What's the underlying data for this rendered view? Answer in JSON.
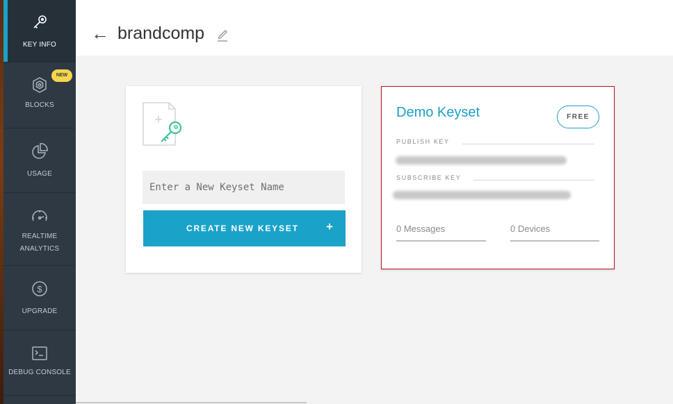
{
  "app": {
    "title": "brandcomp"
  },
  "header": {
    "back_icon": "back-arrow-icon",
    "edit_icon": "pencil-icon"
  },
  "sidebar": {
    "items": [
      {
        "label": "KEY INFO",
        "icon": "key-icon",
        "active": true
      },
      {
        "label": "BLOCKS",
        "icon": "blocks-icon",
        "badge": "NEW"
      },
      {
        "label": "USAGE",
        "icon": "pie-chart-icon"
      },
      {
        "label": "REALTIME\nANALYTICS",
        "icon": "speedometer-icon"
      },
      {
        "label": "UPGRADE",
        "icon": "dollar-icon"
      },
      {
        "label": "DEBUG CONSOLE",
        "icon": "terminal-icon"
      }
    ]
  },
  "create_card": {
    "icon": "add-keyset-icon",
    "input_placeholder": "Enter a New Keyset Name",
    "input_value": "",
    "button_label": "CREATE NEW KEYSET",
    "button_plus": "+"
  },
  "keyset": {
    "name": "Demo Keyset",
    "plan": "FREE",
    "publish_label": "PUBLISH KEY",
    "subscribe_label": "SUBSCRIBE KEY",
    "messages": "0 Messages",
    "devices": "0 Devices"
  },
  "colors": {
    "accent": "#1aa2c9",
    "sidebar": "#2e3944",
    "badge": "#f6d54a",
    "highlight_border": "#c1121f"
  }
}
